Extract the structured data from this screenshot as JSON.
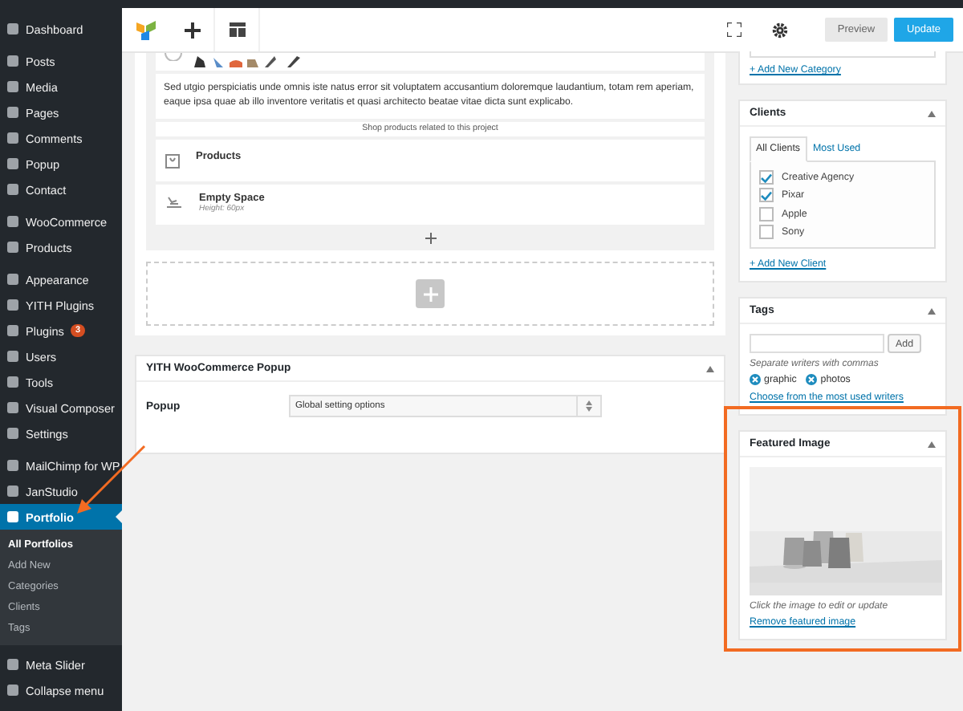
{
  "sidebar": {
    "groups": [
      {
        "items": [
          {
            "label": "Dashboard",
            "selected": false
          }
        ]
      },
      {
        "items": [
          {
            "label": "Posts",
            "selected": false
          },
          {
            "label": "Media",
            "selected": false
          },
          {
            "label": "Pages",
            "selected": false
          },
          {
            "label": "Comments",
            "selected": false
          },
          {
            "label": "Popup",
            "selected": false
          },
          {
            "label": "Contact",
            "selected": false
          }
        ]
      },
      {
        "items": [
          {
            "label": "WooCommerce",
            "selected": false
          },
          {
            "label": "Products",
            "selected": false
          }
        ]
      },
      {
        "items": [
          {
            "label": "Appearance",
            "selected": false
          },
          {
            "label": "YITH Plugins",
            "selected": false
          },
          {
            "label": "Plugins",
            "selected": false,
            "badge": "3"
          },
          {
            "label": "Users",
            "selected": false
          },
          {
            "label": "Tools",
            "selected": false
          },
          {
            "label": "Visual Composer",
            "selected": false
          },
          {
            "label": "Settings",
            "selected": false
          }
        ]
      },
      {
        "items": [
          {
            "label": "MailChimp for WP",
            "selected": false
          },
          {
            "label": "JanStudio",
            "selected": false
          },
          {
            "label": "Portfolio",
            "selected": true,
            "pointer": true,
            "children": [
              {
                "label": "All Portfolios",
                "selected": true
              },
              {
                "label": "Add New",
                "selected": false
              },
              {
                "label": "Categories",
                "selected": false
              },
              {
                "label": "Clients",
                "selected": false
              },
              {
                "label": "Tags",
                "selected": false
              }
            ]
          }
        ]
      },
      {
        "items": [
          {
            "label": "Meta Slider",
            "selected": false
          },
          {
            "label": "Collapse menu",
            "selected": false
          }
        ]
      }
    ]
  },
  "toolbar": {
    "buttons": [
      {
        "label": "Preview",
        "kind": "secondary"
      },
      {
        "label": "Update",
        "kind": "primary"
      }
    ]
  },
  "editor": {
    "description": "Sed utgio perspiciatis unde omnis iste natus error sit voluptatem accusantium doloremque laudantium, totam rem aperiam, eaque ipsa quae ab illo inventore veritatis et quasi architecto beatae vitae dicta sunt explicabo.",
    "separator": "Shop products related to this project",
    "elements": [
      {
        "title": "Products"
      },
      {
        "title": "Empty Space",
        "subtitle": "Height: 60px"
      }
    ]
  },
  "popup_panel": {
    "title": "YITH WooCommerce Popup",
    "field_label": "Popup",
    "value": "Global setting options"
  },
  "categories_panel": {
    "link": "+ Add New Category"
  },
  "clients_panel": {
    "title": "Clients",
    "tabs": [
      {
        "label": "All Clients",
        "selected": true
      },
      {
        "label": "Most Used",
        "selected": false
      }
    ],
    "items": [
      {
        "label": "Creative Agency",
        "checked": true
      },
      {
        "label": "Pixar",
        "checked": true
      },
      {
        "label": "Apple",
        "checked": false
      },
      {
        "label": "Sony",
        "checked": false
      }
    ],
    "link": "+ Add New Client"
  },
  "tags_panel": {
    "title": "Tags",
    "button": "Add",
    "hint": "Separate writers with commas",
    "tags": [
      "graphic",
      "photos"
    ],
    "link": "Choose from the most used writers"
  },
  "featured_panel": {
    "title": "Featured Image",
    "highlighted": true,
    "hint": "Click the image to edit or update",
    "link": "Remove featured image"
  }
}
